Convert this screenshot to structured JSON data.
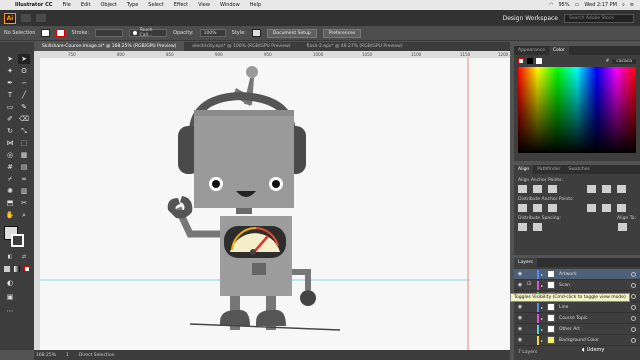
{
  "menubar": {
    "apple": "",
    "app_name": "Illustrator CC",
    "items": [
      "File",
      "Edit",
      "Object",
      "Type",
      "Select",
      "Effect",
      "View",
      "Window",
      "Help"
    ],
    "battery": "95%",
    "clock": "Wed 2:17 PM"
  },
  "appbar": {
    "logo": "Ai",
    "workspace": "Design Workspace",
    "search_placeholder": "Search Adobe Stock"
  },
  "control": {
    "selection": "No Selection",
    "stroke_label": "Stroke:",
    "brush": "Touch Call...",
    "opacity_label": "Opacity:",
    "opacity_value": "100%",
    "style_label": "Style:",
    "document_setup": "Document Setup",
    "preferences": "Preferences"
  },
  "tabs": [
    "Skillshare-Course-Image.ai* @ 168.25% (RGB/GPU Preview)",
    "electricity.eps* @ 100% (RGB/GPU Preview)",
    "flash-2.eps* @ 49.27% (RGB/GPU Preview)"
  ],
  "ruler": [
    "750",
    "800",
    "850",
    "900",
    "950",
    "1000",
    "1050",
    "1100",
    "1150",
    "1200"
  ],
  "status": {
    "zoom": "168.25%",
    "page": "1",
    "tool": "Direct Selection"
  },
  "color_panel": {
    "tabs": [
      "Appearance",
      "Color"
    ],
    "hex": "cacaca"
  },
  "align_panel": {
    "tabs": [
      "Align",
      "Pathfinder",
      "Swatches"
    ],
    "align_objects": "Align Anchor Points:",
    "distribute_objects": "Distribute Anchor Points:",
    "distribute_spacing": "Distribute Spacing:",
    "align_to": "Align To:"
  },
  "layers_panel": {
    "title": "Layers",
    "layers": [
      {
        "name": "Artwork",
        "color": "#4f8ff7"
      },
      {
        "name": "Scan",
        "color": "#e04fd5"
      },
      {
        "name": "Course Title",
        "color": "#4fd54f"
      },
      {
        "name": "Line",
        "color": "#4f8ff7"
      },
      {
        "name": "Course Topic",
        "color": "#e04fd5"
      },
      {
        "name": "Other Art",
        "color": "#4fd5d5"
      },
      {
        "name": "Background Color",
        "color": "#f7d34f"
      }
    ],
    "footer": "7 Layers",
    "tooltip": "Toggles Visibility (Cmd-click to toggle view mode)"
  },
  "watermark": "Udemy"
}
